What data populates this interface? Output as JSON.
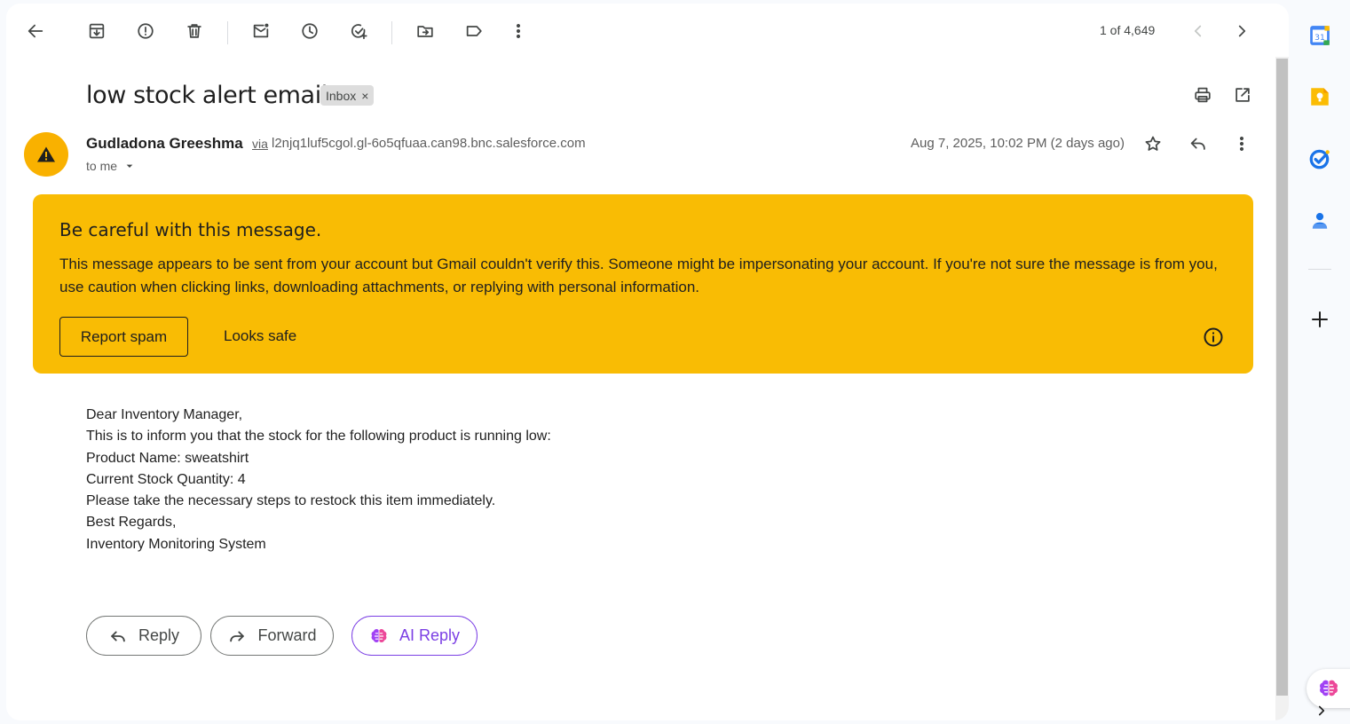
{
  "toolbar": {
    "pager_count": "1 of 4,649"
  },
  "email": {
    "subject": "low stock alert email",
    "label_chip": "Inbox",
    "label_chip_remove": "×",
    "sender_name": "Gudladona Greeshma",
    "via_label": "via",
    "sender_address": "l2njq1luf5cgol.gl-6o5qfuaa.can98.bnc.salesforce.com",
    "recipient": "to me",
    "date": "Aug 7, 2025, 10:02 PM (2 days ago)"
  },
  "warning": {
    "title": "Be careful with this message.",
    "body": "This message appears to be sent from your account but Gmail couldn't verify this. Someone might be impersonating your account. If you're not sure the message is from you, use caution when clicking links, downloading attachments, or replying with personal information.",
    "report_spam": "Report spam",
    "looks_safe": "Looks safe",
    "background_color": "#f9bc04"
  },
  "body": {
    "lines": [
      "Dear Inventory Manager,",
      "This is to inform you that the stock for the following product is running low:",
      "Product Name: sweatshirt",
      "Current Stock Quantity: 4",
      "Please take the necessary steps to restock this item immediately.",
      "Best Regards,",
      "Inventory Monitoring System"
    ]
  },
  "actions": {
    "reply": "Reply",
    "forward": "Forward",
    "ai_reply": "AI Reply",
    "ai_color": "#7b3fe4"
  },
  "side_panel": {
    "calendar_day": "31",
    "apps": [
      "calendar-icon",
      "keep-icon",
      "tasks-icon",
      "contacts-icon",
      "add-icon"
    ]
  }
}
